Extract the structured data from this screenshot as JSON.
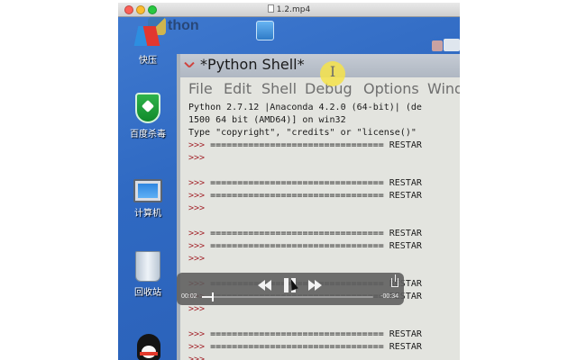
{
  "player": {
    "title": "1.2.mp4",
    "controls": {
      "elapsed": "00:02",
      "remaining": "-00:34",
      "progress_fraction": 0.06
    }
  },
  "desktop": {
    "icons": [
      {
        "label": "快压"
      },
      {
        "label": "百度杀毒"
      },
      {
        "label": "计算机"
      },
      {
        "label": "回收站"
      }
    ],
    "background_logo_text": "thon"
  },
  "shell": {
    "title": "*Python Shell*",
    "menu": [
      "File",
      "Edit",
      "Shell",
      "Debug",
      "Options",
      "Windows"
    ],
    "lines": [
      {
        "prompt": "",
        "text": "Python 2.7.12 |Anaconda 4.2.0 (64-bit)| (de"
      },
      {
        "prompt": "",
        "text": "1500 64 bit (AMD64)] on win32"
      },
      {
        "prompt": "",
        "text": "Type \"copyright\", \"credits\" or \"license()\""
      },
      {
        "prompt": ">>> ",
        "text": "================================ RESTAR"
      },
      {
        "prompt": ">>> ",
        "text": ""
      },
      {
        "prompt": "",
        "text": ""
      },
      {
        "prompt": ">>> ",
        "text": "================================ RESTAR"
      },
      {
        "prompt": ">>> ",
        "text": "================================ RESTAR"
      },
      {
        "prompt": ">>> ",
        "text": ""
      },
      {
        "prompt": "",
        "text": ""
      },
      {
        "prompt": ">>> ",
        "text": "================================ RESTAR"
      },
      {
        "prompt": ">>> ",
        "text": "================================ RESTAR"
      },
      {
        "prompt": ">>> ",
        "text": ""
      },
      {
        "prompt": "",
        "text": ""
      },
      {
        "prompt": ">>> ",
        "text": "================================ RESTAR"
      },
      {
        "prompt": ">>> ",
        "text": "================================ RESTAR"
      },
      {
        "prompt": ">>> ",
        "text": ""
      },
      {
        "prompt": "",
        "text": ""
      },
      {
        "prompt": ">>> ",
        "text": "================================ RESTAR"
      },
      {
        "prompt": ">>> ",
        "text": "================================ RESTAR"
      },
      {
        "prompt": ">>> ",
        "text": ""
      }
    ]
  },
  "colors": {
    "prompt": "#a3242b",
    "shell_bg": "#e3e4df",
    "desktop_bg": "#2f69c2",
    "cursor_highlight": "#f6e34a"
  }
}
